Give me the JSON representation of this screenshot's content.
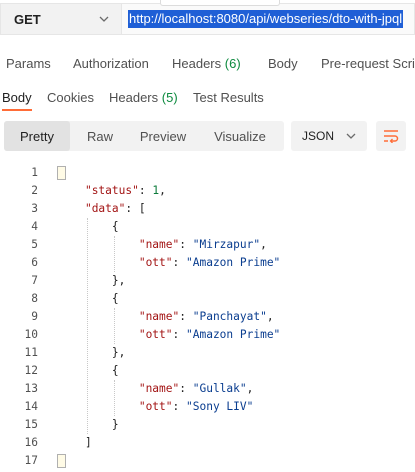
{
  "request": {
    "method": "GET",
    "url": "http://localhost:8080/api/webseries/dto-with-jpql"
  },
  "request_tabs": [
    {
      "label": "Params"
    },
    {
      "label": "Authorization"
    },
    {
      "label": "Headers",
      "count": "(6)"
    },
    {
      "label": "Body"
    },
    {
      "label": "Pre-request Script"
    }
  ],
  "response_tabs": [
    {
      "label": "Body"
    },
    {
      "label": "Cookies"
    },
    {
      "label": "Headers",
      "count": "(5)"
    },
    {
      "label": "Test Results"
    }
  ],
  "view": {
    "options": [
      "Pretty",
      "Raw",
      "Preview",
      "Visualize"
    ],
    "active": "Pretty",
    "format": "JSON",
    "wrap_icon": "wrap-lines-icon"
  },
  "colors": {
    "accent": "#ff6c37",
    "count_green": "#0d8a3f",
    "selection": "#1f5fd6"
  },
  "code_lines": [
    {
      "n": "1",
      "parts": [
        [
          "p",
          "{"
        ]
      ]
    },
    {
      "n": "2",
      "parts": [
        [
          "p",
          "    "
        ],
        [
          "k",
          "\"status\""
        ],
        [
          "p",
          ": "
        ],
        [
          "num",
          "1"
        ],
        [
          "p",
          ","
        ]
      ]
    },
    {
      "n": "3",
      "parts": [
        [
          "p",
          "    "
        ],
        [
          "k",
          "\"data\""
        ],
        [
          "p",
          ": ["
        ]
      ]
    },
    {
      "n": "4",
      "parts": [
        [
          "p",
          "        {"
        ]
      ]
    },
    {
      "n": "5",
      "parts": [
        [
          "p",
          "            "
        ],
        [
          "k",
          "\"name\""
        ],
        [
          "p",
          ": "
        ],
        [
          "s",
          "\"Mirzapur\""
        ],
        [
          "p",
          ","
        ]
      ]
    },
    {
      "n": "6",
      "parts": [
        [
          "p",
          "            "
        ],
        [
          "k",
          "\"ott\""
        ],
        [
          "p",
          ": "
        ],
        [
          "s",
          "\"Amazon Prime\""
        ]
      ]
    },
    {
      "n": "7",
      "parts": [
        [
          "p",
          "        },"
        ]
      ]
    },
    {
      "n": "8",
      "parts": [
        [
          "p",
          "        {"
        ]
      ]
    },
    {
      "n": "9",
      "parts": [
        [
          "p",
          "            "
        ],
        [
          "k",
          "\"name\""
        ],
        [
          "p",
          ": "
        ],
        [
          "s",
          "\"Panchayat\""
        ],
        [
          "p",
          ","
        ]
      ]
    },
    {
      "n": "10",
      "parts": [
        [
          "p",
          "            "
        ],
        [
          "k",
          "\"ott\""
        ],
        [
          "p",
          ": "
        ],
        [
          "s",
          "\"Amazon Prime\""
        ]
      ]
    },
    {
      "n": "11",
      "parts": [
        [
          "p",
          "        },"
        ]
      ]
    },
    {
      "n": "12",
      "parts": [
        [
          "p",
          "        {"
        ]
      ]
    },
    {
      "n": "13",
      "parts": [
        [
          "p",
          "            "
        ],
        [
          "k",
          "\"name\""
        ],
        [
          "p",
          ": "
        ],
        [
          "s",
          "\"Gullak\""
        ],
        [
          "p",
          ","
        ]
      ]
    },
    {
      "n": "14",
      "parts": [
        [
          "p",
          "            "
        ],
        [
          "k",
          "\"ott\""
        ],
        [
          "p",
          ": "
        ],
        [
          "s",
          "\"Sony LIV\""
        ]
      ]
    },
    {
      "n": "15",
      "parts": [
        [
          "p",
          "        }"
        ]
      ]
    },
    {
      "n": "16",
      "parts": [
        [
          "p",
          "    ]"
        ]
      ]
    },
    {
      "n": "17",
      "parts": [
        [
          "p",
          "}"
        ]
      ]
    }
  ]
}
